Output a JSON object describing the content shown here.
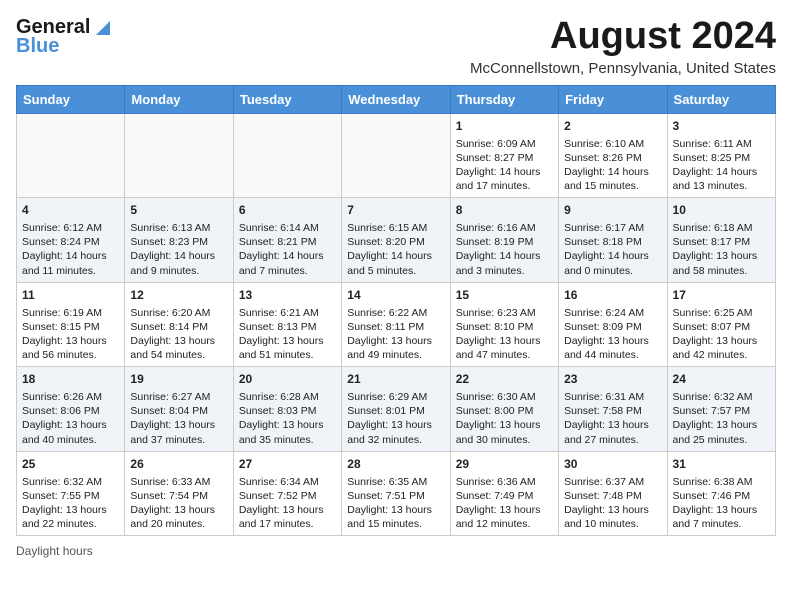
{
  "logo": {
    "line1": "General",
    "line2": "Blue"
  },
  "title": "August 2024",
  "location": "McConnellstown, Pennsylvania, United States",
  "days_of_week": [
    "Sunday",
    "Monday",
    "Tuesday",
    "Wednesday",
    "Thursday",
    "Friday",
    "Saturday"
  ],
  "footer": "Daylight hours",
  "weeks": [
    [
      {
        "day": "",
        "info": ""
      },
      {
        "day": "",
        "info": ""
      },
      {
        "day": "",
        "info": ""
      },
      {
        "day": "",
        "info": ""
      },
      {
        "day": "1",
        "info": "Sunrise: 6:09 AM\nSunset: 8:27 PM\nDaylight: 14 hours and 17 minutes."
      },
      {
        "day": "2",
        "info": "Sunrise: 6:10 AM\nSunset: 8:26 PM\nDaylight: 14 hours and 15 minutes."
      },
      {
        "day": "3",
        "info": "Sunrise: 6:11 AM\nSunset: 8:25 PM\nDaylight: 14 hours and 13 minutes."
      }
    ],
    [
      {
        "day": "4",
        "info": "Sunrise: 6:12 AM\nSunset: 8:24 PM\nDaylight: 14 hours and 11 minutes."
      },
      {
        "day": "5",
        "info": "Sunrise: 6:13 AM\nSunset: 8:23 PM\nDaylight: 14 hours and 9 minutes."
      },
      {
        "day": "6",
        "info": "Sunrise: 6:14 AM\nSunset: 8:21 PM\nDaylight: 14 hours and 7 minutes."
      },
      {
        "day": "7",
        "info": "Sunrise: 6:15 AM\nSunset: 8:20 PM\nDaylight: 14 hours and 5 minutes."
      },
      {
        "day": "8",
        "info": "Sunrise: 6:16 AM\nSunset: 8:19 PM\nDaylight: 14 hours and 3 minutes."
      },
      {
        "day": "9",
        "info": "Sunrise: 6:17 AM\nSunset: 8:18 PM\nDaylight: 14 hours and 0 minutes."
      },
      {
        "day": "10",
        "info": "Sunrise: 6:18 AM\nSunset: 8:17 PM\nDaylight: 13 hours and 58 minutes."
      }
    ],
    [
      {
        "day": "11",
        "info": "Sunrise: 6:19 AM\nSunset: 8:15 PM\nDaylight: 13 hours and 56 minutes."
      },
      {
        "day": "12",
        "info": "Sunrise: 6:20 AM\nSunset: 8:14 PM\nDaylight: 13 hours and 54 minutes."
      },
      {
        "day": "13",
        "info": "Sunrise: 6:21 AM\nSunset: 8:13 PM\nDaylight: 13 hours and 51 minutes."
      },
      {
        "day": "14",
        "info": "Sunrise: 6:22 AM\nSunset: 8:11 PM\nDaylight: 13 hours and 49 minutes."
      },
      {
        "day": "15",
        "info": "Sunrise: 6:23 AM\nSunset: 8:10 PM\nDaylight: 13 hours and 47 minutes."
      },
      {
        "day": "16",
        "info": "Sunrise: 6:24 AM\nSunset: 8:09 PM\nDaylight: 13 hours and 44 minutes."
      },
      {
        "day": "17",
        "info": "Sunrise: 6:25 AM\nSunset: 8:07 PM\nDaylight: 13 hours and 42 minutes."
      }
    ],
    [
      {
        "day": "18",
        "info": "Sunrise: 6:26 AM\nSunset: 8:06 PM\nDaylight: 13 hours and 40 minutes."
      },
      {
        "day": "19",
        "info": "Sunrise: 6:27 AM\nSunset: 8:04 PM\nDaylight: 13 hours and 37 minutes."
      },
      {
        "day": "20",
        "info": "Sunrise: 6:28 AM\nSunset: 8:03 PM\nDaylight: 13 hours and 35 minutes."
      },
      {
        "day": "21",
        "info": "Sunrise: 6:29 AM\nSunset: 8:01 PM\nDaylight: 13 hours and 32 minutes."
      },
      {
        "day": "22",
        "info": "Sunrise: 6:30 AM\nSunset: 8:00 PM\nDaylight: 13 hours and 30 minutes."
      },
      {
        "day": "23",
        "info": "Sunrise: 6:31 AM\nSunset: 7:58 PM\nDaylight: 13 hours and 27 minutes."
      },
      {
        "day": "24",
        "info": "Sunrise: 6:32 AM\nSunset: 7:57 PM\nDaylight: 13 hours and 25 minutes."
      }
    ],
    [
      {
        "day": "25",
        "info": "Sunrise: 6:32 AM\nSunset: 7:55 PM\nDaylight: 13 hours and 22 minutes."
      },
      {
        "day": "26",
        "info": "Sunrise: 6:33 AM\nSunset: 7:54 PM\nDaylight: 13 hours and 20 minutes."
      },
      {
        "day": "27",
        "info": "Sunrise: 6:34 AM\nSunset: 7:52 PM\nDaylight: 13 hours and 17 minutes."
      },
      {
        "day": "28",
        "info": "Sunrise: 6:35 AM\nSunset: 7:51 PM\nDaylight: 13 hours and 15 minutes."
      },
      {
        "day": "29",
        "info": "Sunrise: 6:36 AM\nSunset: 7:49 PM\nDaylight: 13 hours and 12 minutes."
      },
      {
        "day": "30",
        "info": "Sunrise: 6:37 AM\nSunset: 7:48 PM\nDaylight: 13 hours and 10 minutes."
      },
      {
        "day": "31",
        "info": "Sunrise: 6:38 AM\nSunset: 7:46 PM\nDaylight: 13 hours and 7 minutes."
      }
    ]
  ]
}
